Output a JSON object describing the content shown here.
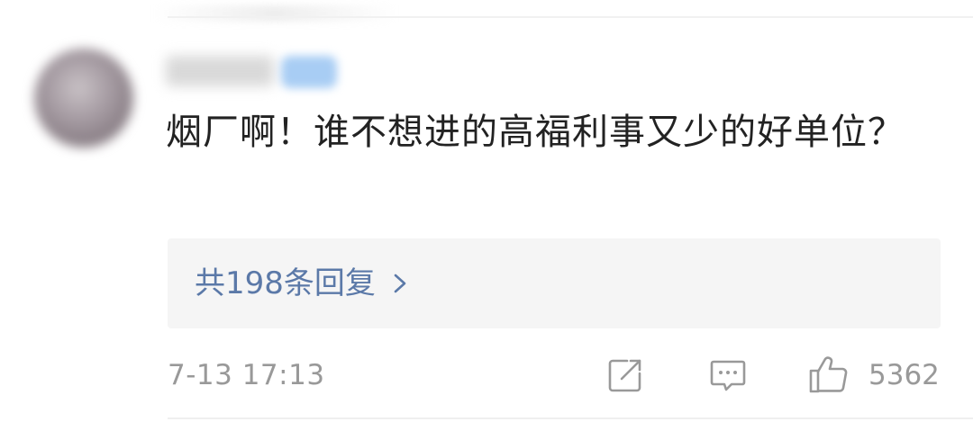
{
  "comment": {
    "text": "烟厂啊！谁不想进的高福利事又少的好单位？",
    "reply_link": "共198条回复",
    "timestamp": "7-13 17:13",
    "like_count": "5362"
  },
  "icons": {
    "reply_chevron": "chevron-right-icon",
    "share": "share-icon",
    "comment": "comment-icon",
    "like": "thumbs-up-icon"
  },
  "colors": {
    "link": "#5b79a8",
    "muted": "#999999",
    "text": "#222222",
    "reply_background": "#f5f5f5"
  }
}
